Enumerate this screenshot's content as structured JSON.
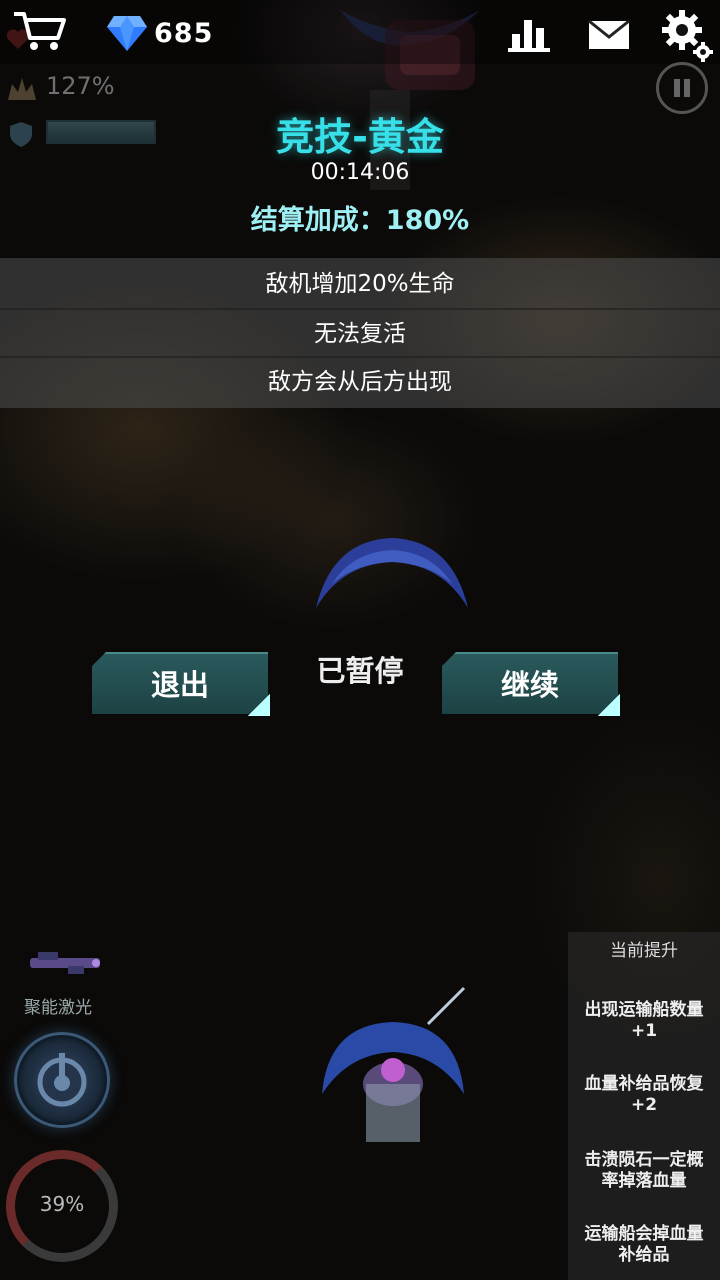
{
  "hud": {
    "cart_icon": "cart-icon",
    "gem_icon": "diamond-icon",
    "gems": "685",
    "stat_percent": "127%",
    "ranking_icon": "bar-chart-icon",
    "mail_icon": "mail-icon",
    "settings_icon": "gear-icon"
  },
  "arena": {
    "title": "竞技-黄金",
    "timer": "00:14:06",
    "bonus": "结算加成：180%",
    "rules": [
      "敌机增加20%生命",
      "无法复活",
      "敌方会从后方出现"
    ]
  },
  "pause": {
    "label": "已暂停",
    "exit": "退出",
    "continue": "继续"
  },
  "weapon": {
    "label": "聚能激光",
    "energy": "39%"
  },
  "upgrades": {
    "title": "当前提升",
    "items": [
      "出现运输船数量\n+1",
      "血量补给品恢复\n+2",
      "击溃陨石一定概\n率掉落血量",
      "运输船会掉血量\n补给品"
    ]
  },
  "colors": {
    "title_cyan": "#37e0e8",
    "button_teal": "#1d4244",
    "gem_blue": "#2f7cff"
  }
}
